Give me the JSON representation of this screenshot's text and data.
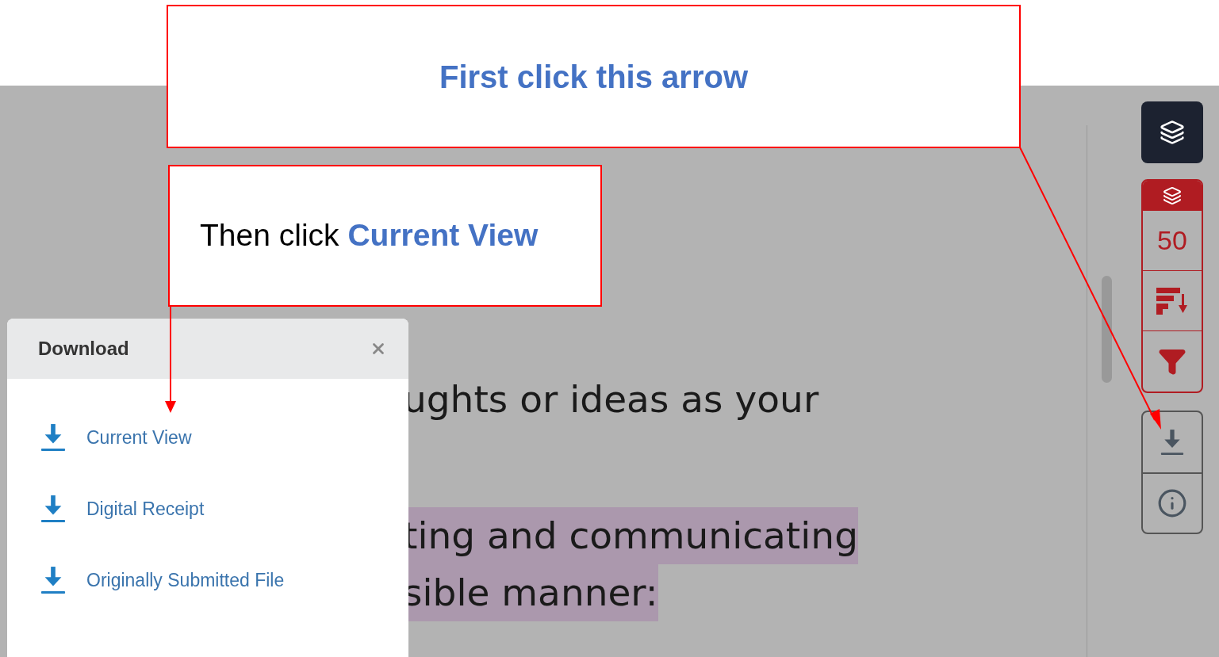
{
  "callouts": [
    {
      "text": "First click this arrow"
    },
    {
      "text": "Then click **Current View**"
    }
  ],
  "document": {
    "lines": [
      {
        "text": "ughts or ideas as your",
        "highlighted": false
      },
      {
        "text": "ting and communicating",
        "highlighted": true
      },
      {
        "text": "sible manner:",
        "highlighted": true
      }
    ]
  },
  "toolbar": {
    "count": "50"
  },
  "download_panel": {
    "title": "Download",
    "items": [
      {
        "label": "Current View"
      },
      {
        "label": "Digital Receipt"
      },
      {
        "label": "Originally Submitted File"
      }
    ]
  }
}
